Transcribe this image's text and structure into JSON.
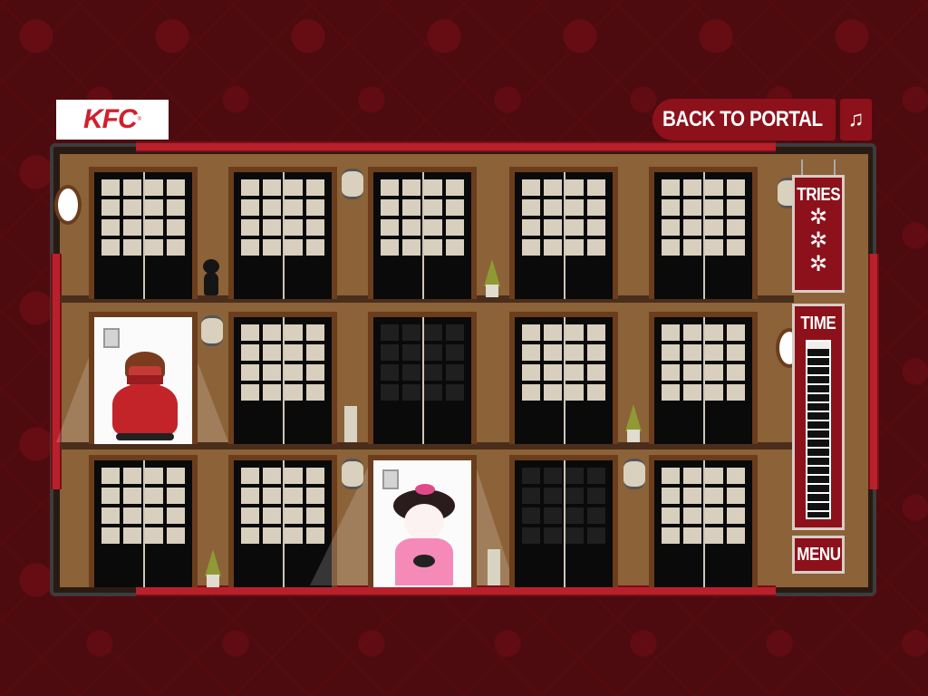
{
  "header": {
    "logo_text": "KFC",
    "logo_registered": "®",
    "back_to_portal_label": "BACK TO PORTAL",
    "music_icon_glyph": "♫"
  },
  "side_panel": {
    "tries_label": "TRIES",
    "tries_remaining": 3,
    "shuriken_glyph": "✲",
    "time_label": "TIME",
    "time_remaining_fraction": 0.96,
    "menu_label": "MENU"
  },
  "colors": {
    "background": "#4d0b10",
    "panel_red": "#8d111a",
    "rail_red": "#b8202c",
    "wall_brown": "#8c6238",
    "kfc_red": "#d21f2b"
  },
  "doors": {
    "rows": [
      [
        "closed",
        "closed",
        "closed",
        "closed",
        "closed"
      ],
      [
        "open-ninja",
        "closed",
        "dark",
        "closed",
        "closed"
      ],
      [
        "closed",
        "closed",
        "open-geisha",
        "dark",
        "closed"
      ]
    ]
  },
  "icons": {
    "music": "music-note-icon",
    "portal": "swirl-icon",
    "tries": "shuriken-icon"
  }
}
